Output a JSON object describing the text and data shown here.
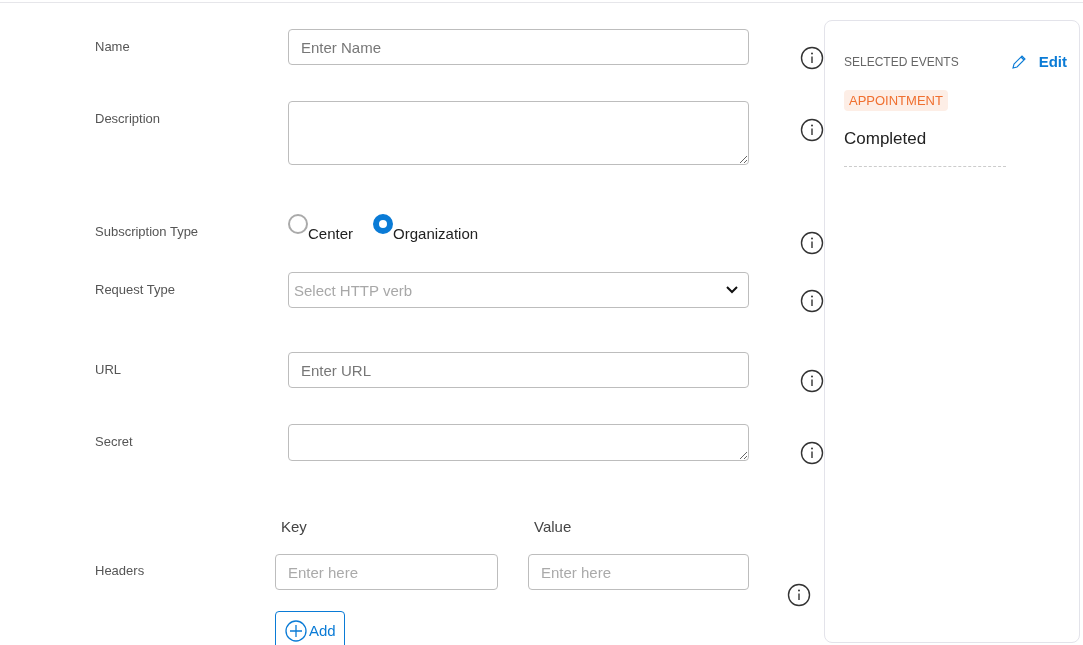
{
  "form": {
    "fields": [
      {
        "kind": "text",
        "label": "Name",
        "placeholder": "Enter Name"
      },
      {
        "kind": "textarea",
        "label": "Description"
      },
      {
        "kind": "radio",
        "label": "Subscription Type",
        "options": [
          {
            "label": "Center",
            "selected": false
          },
          {
            "label": "Organization",
            "selected": true
          }
        ]
      },
      {
        "kind": "select",
        "label": "Request Type",
        "placeholder": "Select HTTP verb"
      },
      {
        "kind": "text",
        "label": "URL",
        "placeholder": "Enter URL"
      },
      {
        "kind": "textarea",
        "label": "Secret"
      },
      {
        "kind": "headers",
        "label": "Headers",
        "key_label": "Key",
        "value_label": "Value",
        "key_placeholder": "Enter here",
        "value_placeholder": "Enter here",
        "add_button": "Add"
      }
    ]
  },
  "selected_events": {
    "title": "SELECTED EVENTS",
    "edit": "Edit",
    "category": "APPOINTMENT",
    "events": [
      "Completed"
    ]
  }
}
